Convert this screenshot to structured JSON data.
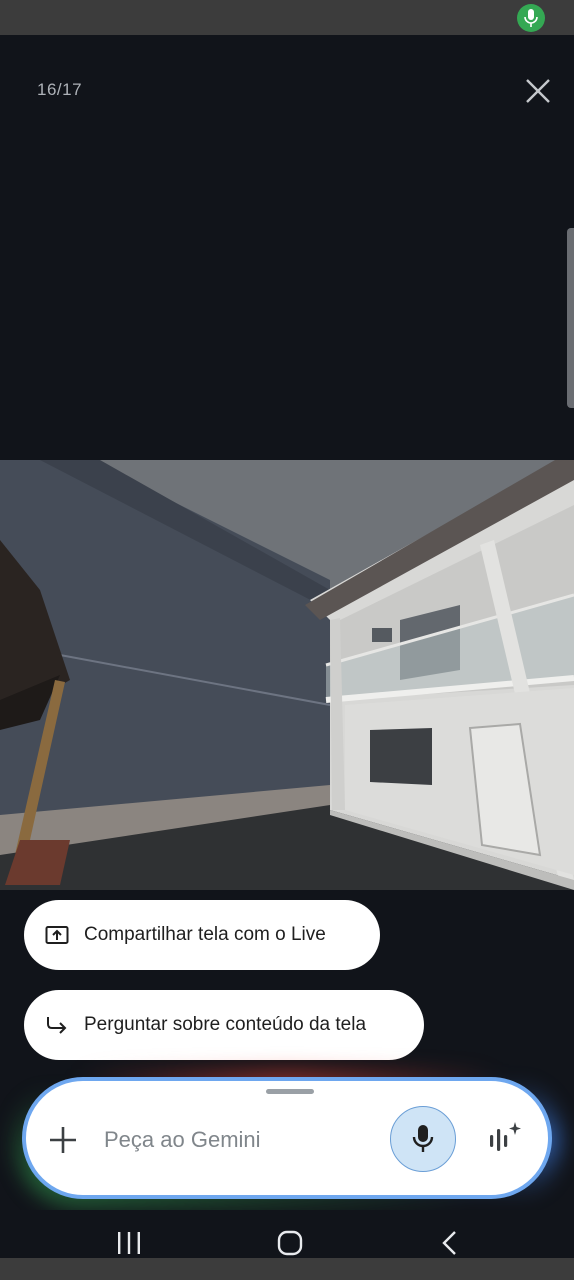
{
  "viewer": {
    "counter": "16/17",
    "close_icon": "close-icon",
    "photo_description_icon": "photo"
  },
  "suggestions": [
    {
      "icon": "screen-share-icon",
      "label": "Compartilhar tela com o Live"
    },
    {
      "icon": "forward-arrow-icon",
      "label": "Perguntar sobre conteúdo da tela"
    }
  ],
  "composer": {
    "placeholder": "Peça ao Gemini",
    "add_icon": "plus-icon",
    "mic_icon": "microphone-icon",
    "live_icon": "gemini-live-icon"
  },
  "status": {
    "mic_indicator_color": "#34a853"
  },
  "colors": {
    "background": "#11141a",
    "accent_blue": "#6ea7ef",
    "mic_bg": "#cfe4f6"
  }
}
